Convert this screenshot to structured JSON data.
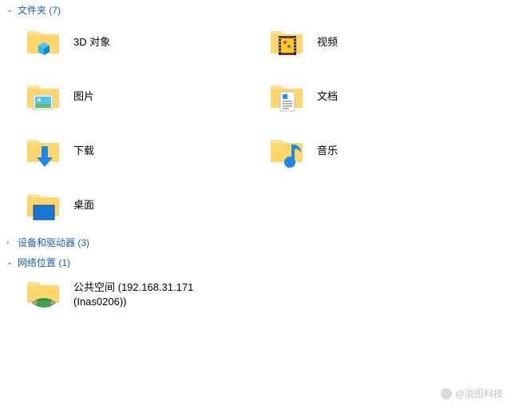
{
  "sections": {
    "folders": {
      "title": "文件夹",
      "count": 7,
      "expanded": true
    },
    "devices": {
      "title": "设备和驱动器",
      "count": 3,
      "expanded": false
    },
    "network": {
      "title": "网络位置",
      "count": 1,
      "expanded": true
    }
  },
  "folder_items": [
    {
      "label": "3D 对象",
      "icon": "folder-3d"
    },
    {
      "label": "视频",
      "icon": "folder-video"
    },
    {
      "label": "图片",
      "icon": "folder-pictures"
    },
    {
      "label": "文档",
      "icon": "folder-documents"
    },
    {
      "label": "下载",
      "icon": "folder-downloads"
    },
    {
      "label": "音乐",
      "icon": "folder-music"
    },
    {
      "label": "桌面",
      "icon": "folder-desktop"
    }
  ],
  "network_items": [
    {
      "label_line1": "公共空间 (192.168.31.171",
      "label_line2": "(Inas0206))",
      "icon": "network-folder"
    }
  ],
  "watermark": "@溢图科技"
}
